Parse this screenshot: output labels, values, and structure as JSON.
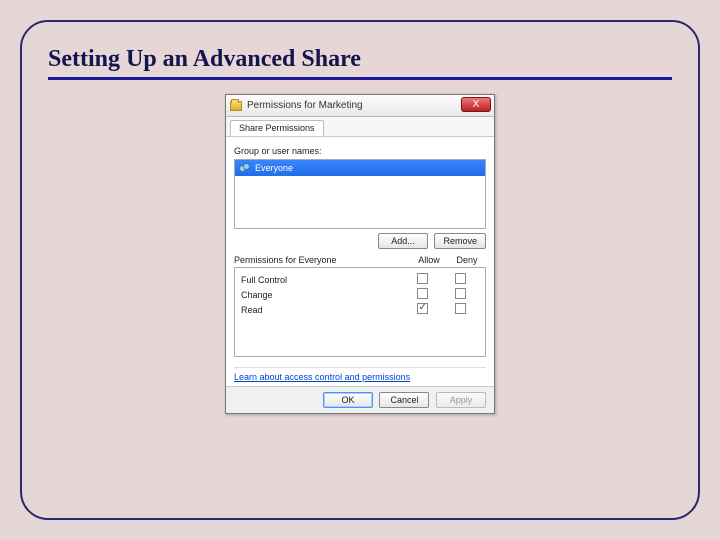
{
  "slide": {
    "title": "Setting Up an Advanced Share"
  },
  "dialog": {
    "title": "Permissions for Marketing",
    "close_label": "X",
    "tab": "Share Permissions",
    "group_label": "Group or user names:",
    "users": [
      {
        "name": "Everyone"
      }
    ],
    "add_label": "Add...",
    "remove_label": "Remove",
    "perm_header": "Permissions for Everyone",
    "allow_label": "Allow",
    "deny_label": "Deny",
    "permissions": [
      {
        "name": "Full Control",
        "allow": false,
        "deny": false
      },
      {
        "name": "Change",
        "allow": false,
        "deny": false
      },
      {
        "name": "Read",
        "allow": true,
        "deny": false
      }
    ],
    "link": "Learn about access control and permissions",
    "ok_label": "OK",
    "cancel_label": "Cancel",
    "apply_label": "Apply"
  }
}
